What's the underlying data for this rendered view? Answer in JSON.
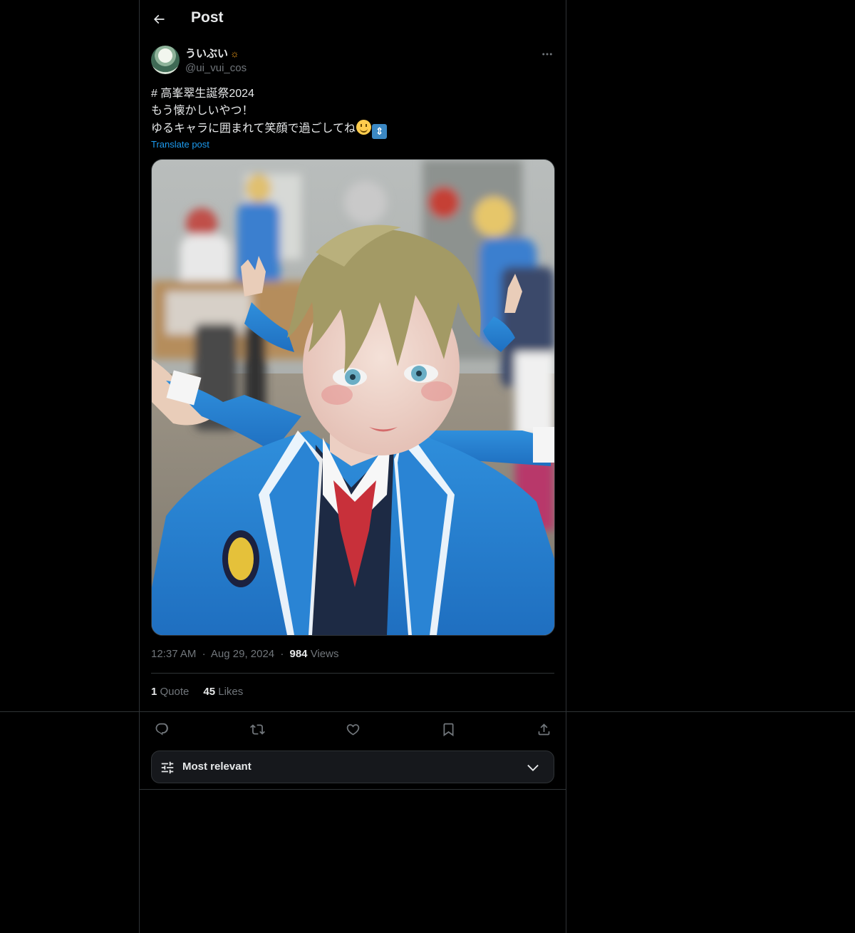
{
  "header": {
    "title": "Post"
  },
  "author": {
    "display_name": "ういぶい",
    "name_emoji": "☼",
    "handle": "@ui_vui_cos"
  },
  "post": {
    "lines": [
      "# 高峯翠生誕祭2024",
      "もう懐かしいやつ！",
      "ゆるキャラに囲まれて笑顔で過ごしてね"
    ],
    "translate_label": "Translate post"
  },
  "meta": {
    "time": "12:37 AM",
    "separator": "·",
    "date": "Aug 29, 2024",
    "views_count": "984",
    "views_label": "Views"
  },
  "stats": {
    "quotes_count": "1",
    "quotes_label": "Quote",
    "likes_count": "45",
    "likes_label": "Likes"
  },
  "actions": {
    "icons": [
      "reply-icon",
      "repost-icon",
      "like-icon",
      "bookmark-icon",
      "share-icon"
    ]
  },
  "sort": {
    "label": "Most relevant"
  },
  "colors": {
    "background": "#000000",
    "text": "#e7e9ea",
    "muted": "#71767b",
    "link": "#1d9bf0",
    "border": "#2f3336"
  }
}
